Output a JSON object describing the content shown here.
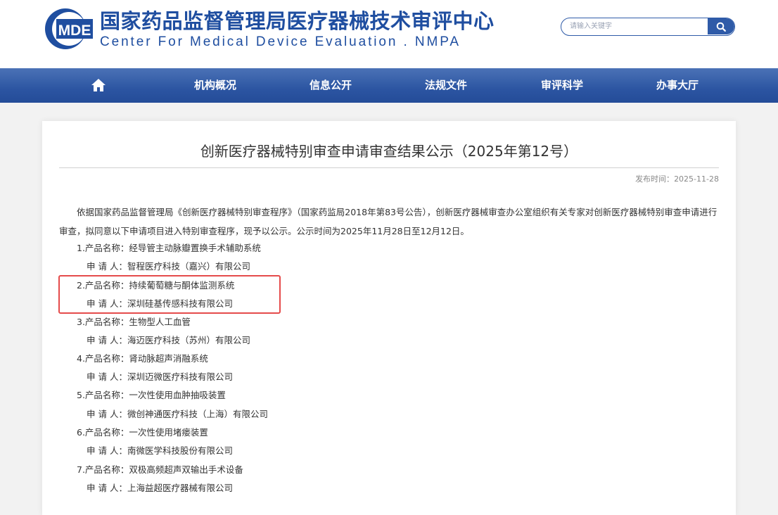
{
  "header": {
    "logo_abbr": "MDE",
    "org_name_cn": "国家药品监督管理局医疗器械技术审评中心",
    "org_name_en": "Center For Medical Device Evaluation . NMPA",
    "search": {
      "placeholder": "请输入关键字"
    }
  },
  "nav": {
    "home_icon": "home-icon",
    "items": [
      "机构概况",
      "信息公开",
      "法规文件",
      "审评科学",
      "办事大厅"
    ]
  },
  "article": {
    "title": "创新医疗器械特别审查申请审查结果公示（2025年第12号）",
    "publish_label": "发布时间：",
    "publish_date": "2025-11-28",
    "intro": "依据国家药品监督管理局《创新医疗器械特别审查程序》（国家药监局2018年第83号公告），创新医疗器械审查办公室组织有关专家对创新医疗器械特别审查申请进行审查，拟同意以下申请项目进入特别审查程序，现予以公示。公示时间为2025年11月28日至12月12日。",
    "items": [
      {
        "product": "1.产品名称：经导管主动脉瓣置换手术辅助系统",
        "applicant": "申 请 人：智程医疗科技（嘉兴）有限公司"
      },
      {
        "product": "2.产品名称：持续葡萄糖与酮体监测系统",
        "applicant": "申 请 人：深圳硅基传感科技有限公司"
      },
      {
        "product": "3.产品名称：生物型人工血管",
        "applicant": "申 请 人：海迈医疗科技（苏州）有限公司"
      },
      {
        "product": "4.产品名称：肾动脉超声消融系统",
        "applicant": "申 请 人：深圳迈微医疗科技有限公司"
      },
      {
        "product": "5.产品名称：一次性使用血肿抽吸装置",
        "applicant": "申 请 人：微创神通医疗科技（上海）有限公司"
      },
      {
        "product": "6.产品名称：一次性使用堵瘘装置",
        "applicant": "申 请 人：南微医学科技股份有限公司"
      },
      {
        "product": "7.产品名称：双极高频超声双输出手术设备",
        "applicant": "申 请 人：上海益超医疗器械有限公司"
      }
    ],
    "highlight_color": "#e54b4b"
  }
}
